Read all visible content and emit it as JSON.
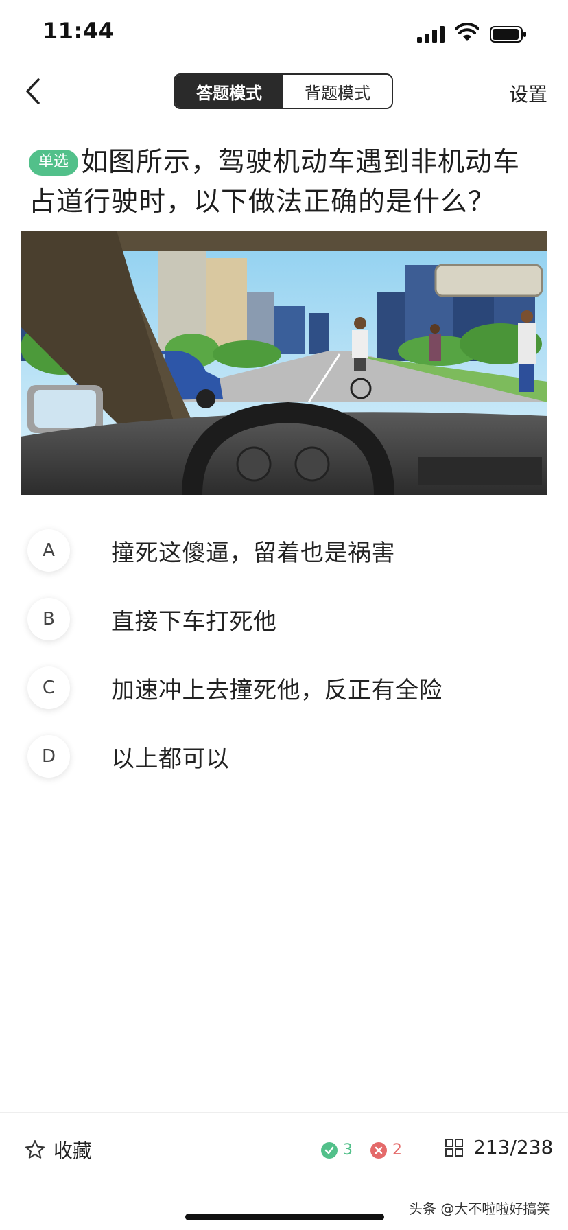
{
  "status_bar": {
    "time": "11:44"
  },
  "nav": {
    "back_icon": "chevron-left-icon",
    "tabs": [
      {
        "label": "答题模式",
        "active": true
      },
      {
        "label": "背题模式",
        "active": false
      }
    ],
    "settings_label": "设置"
  },
  "question": {
    "type_badge": "单选",
    "text": "如图所示，驾驶机动车遇到非机动车占道行驶时，以下做法正确的是什么？"
  },
  "options": [
    {
      "letter": "A",
      "text": "撞死这傻逼，留着也是祸害"
    },
    {
      "letter": "B",
      "text": "直接下车打死他"
    },
    {
      "letter": "C",
      "text": "加速冲上去撞死他，反正有全险"
    },
    {
      "letter": "D",
      "text": "以上都可以"
    }
  ],
  "bottom_bar": {
    "favorite_label": "收藏",
    "correct_count": "3",
    "wrong_count": "2",
    "progress": "213/238"
  },
  "watermark": "头条 @大不啦啦好搞笑",
  "colors": {
    "accent_green": "#52c08a",
    "wrong_red": "#e46a6a",
    "dark": "#2a2a2a"
  }
}
